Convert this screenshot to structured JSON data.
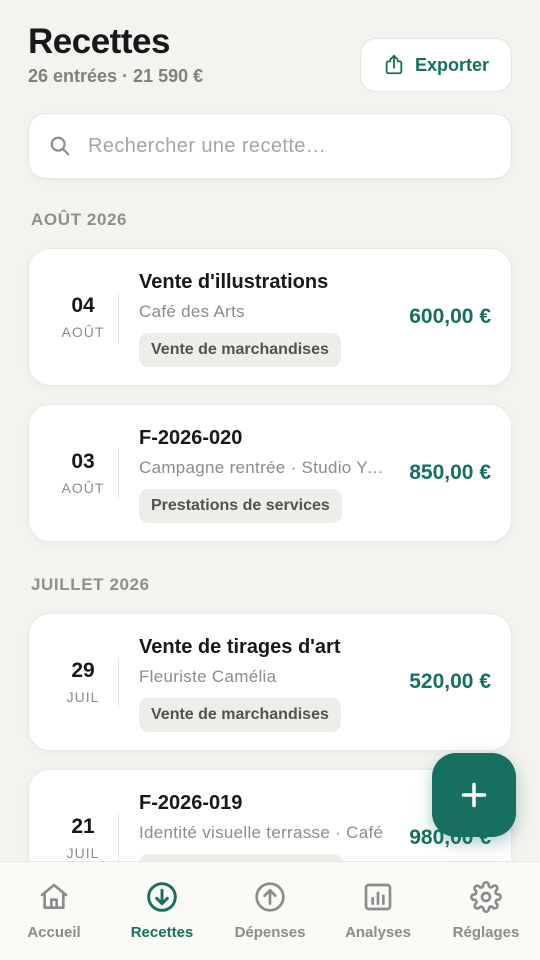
{
  "header": {
    "title": "Recettes",
    "subtitle": "26 entrées · 21 590 €",
    "export_label": "Exporter"
  },
  "search": {
    "placeholder": "Rechercher une recette…"
  },
  "sections": [
    {
      "label": "AOÛT 2026",
      "items": [
        {
          "day": "04",
          "month": "AOÛT",
          "title": "Vente d'illustrations",
          "subtitle": "Café des Arts",
          "category": "Vente de marchandises",
          "amount": "600,00 €"
        },
        {
          "day": "03",
          "month": "AOÛT",
          "title": "F-2026-020",
          "subtitle": "Campagne rentrée · Studio Ypsilon",
          "category": "Prestations de services",
          "amount": "850,00 €"
        }
      ]
    },
    {
      "label": "JUILLET 2026",
      "items": [
        {
          "day": "29",
          "month": "JUIL",
          "title": "Vente de tirages d'art",
          "subtitle": "Fleuriste Camélia",
          "category": "Vente de marchandises",
          "amount": "520,00 €"
        },
        {
          "day": "21",
          "month": "JUIL",
          "title": "F-2026-019",
          "subtitle": "Identité visuelle terrasse · Café",
          "category": "",
          "amount": "980,00 €"
        }
      ]
    }
  ],
  "bottom_nav": [
    {
      "label": "Accueil",
      "icon": "home-icon"
    },
    {
      "label": "Recettes",
      "icon": "arrow-down-circle-icon",
      "active": true
    },
    {
      "label": "Dépenses",
      "icon": "arrow-up-circle-icon"
    },
    {
      "label": "Analyses",
      "icon": "bar-chart-icon"
    },
    {
      "label": "Réglages",
      "icon": "gear-icon"
    }
  ],
  "colors": {
    "accent": "#17705f",
    "background": "#f4f3ef",
    "muted": "#8a8d8b"
  }
}
